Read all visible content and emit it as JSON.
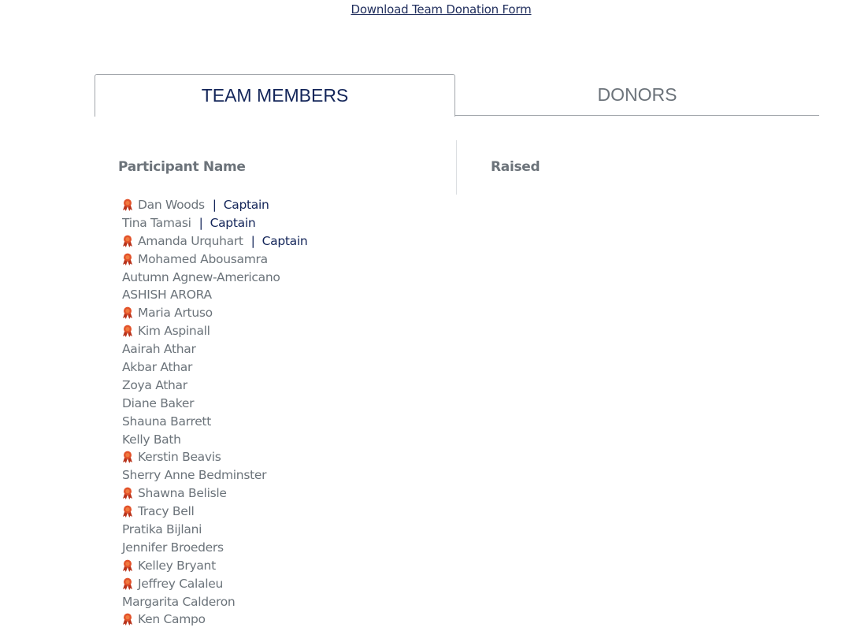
{
  "download_link": "Download Team Donation Form",
  "tabs": [
    {
      "label": "TEAM MEMBERS",
      "active": true
    },
    {
      "label": "DONORS",
      "active": false
    }
  ],
  "columns": {
    "name": "Participant Name",
    "raised": "Raised"
  },
  "colors": {
    "navy": "#132559",
    "gray_text": "#6b737a",
    "ribbon": "#d4411b"
  },
  "members": [
    {
      "name": "Dan Woods",
      "ribbon": true,
      "role": "Captain"
    },
    {
      "name": "Tina Tamasi",
      "ribbon": false,
      "role": "Captain"
    },
    {
      "name": "Amanda Urquhart",
      "ribbon": true,
      "role": "Captain"
    },
    {
      "name": "Mohamed Abousamra",
      "ribbon": true,
      "role": ""
    },
    {
      "name": "Autumn Agnew-Americano",
      "ribbon": false,
      "role": ""
    },
    {
      "name": "ASHISH ARORA",
      "ribbon": false,
      "role": ""
    },
    {
      "name": "Maria Artuso",
      "ribbon": true,
      "role": ""
    },
    {
      "name": "Kim Aspinall",
      "ribbon": true,
      "role": ""
    },
    {
      "name": "Aairah Athar",
      "ribbon": false,
      "role": ""
    },
    {
      "name": "Akbar Athar",
      "ribbon": false,
      "role": ""
    },
    {
      "name": "Zoya Athar",
      "ribbon": false,
      "role": ""
    },
    {
      "name": "Diane Baker",
      "ribbon": false,
      "role": ""
    },
    {
      "name": "Shauna Barrett",
      "ribbon": false,
      "role": ""
    },
    {
      "name": "Kelly Bath",
      "ribbon": false,
      "role": ""
    },
    {
      "name": "Kerstin Beavis",
      "ribbon": true,
      "role": ""
    },
    {
      "name": "Sherry Anne Bedminster",
      "ribbon": false,
      "role": ""
    },
    {
      "name": "Shawna Belisle",
      "ribbon": true,
      "role": ""
    },
    {
      "name": "Tracy Bell",
      "ribbon": true,
      "role": ""
    },
    {
      "name": "Pratika Bijlani",
      "ribbon": false,
      "role": ""
    },
    {
      "name": "Jennifer Broeders",
      "ribbon": false,
      "role": ""
    },
    {
      "name": "Kelley Bryant",
      "ribbon": true,
      "role": ""
    },
    {
      "name": "Jeffrey Calaleu",
      "ribbon": true,
      "role": ""
    },
    {
      "name": "Margarita Calderon",
      "ribbon": false,
      "role": ""
    },
    {
      "name": "Ken Campo",
      "ribbon": true,
      "role": ""
    }
  ]
}
